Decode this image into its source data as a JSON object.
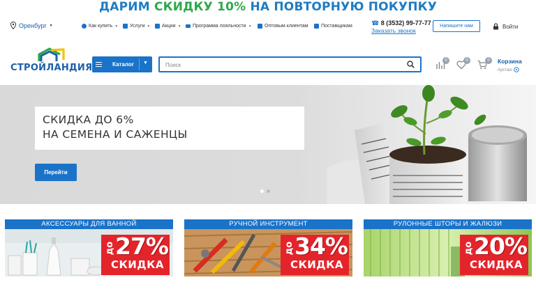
{
  "promo": {
    "part1": "ДАРИМ ",
    "part2": "СКИДКУ 10%",
    "part3": " НА ПОВТОРНУЮ ПОКУПКУ"
  },
  "header": {
    "city": "Оренбург",
    "nav": [
      {
        "label": "Как купить",
        "caret": true
      },
      {
        "label": "Услуги",
        "caret": true
      },
      {
        "label": "Акции",
        "caret": true
      },
      {
        "label": "Программа лояльности",
        "caret": true
      },
      {
        "label": "Оптовым клиентам",
        "caret": false
      },
      {
        "label": "Поставщикам",
        "caret": false
      }
    ],
    "phone": "8 (3532) 99-77-77",
    "callback": "Заказать звонок",
    "write_button": "Напишите нам",
    "login": "Войти"
  },
  "logo": {
    "text": "СТРОЙЛАНДИЯ"
  },
  "catalog": {
    "label": "Каталог"
  },
  "search": {
    "placeholder": "Поиск"
  },
  "counters": {
    "compare": "0",
    "favorites": "0",
    "cart": "0"
  },
  "cart": {
    "title": "Корзина",
    "status": "пустая"
  },
  "hero": {
    "line1": "СКИДКА ДО 6%",
    "line2": "НА СЕМЕНА И САЖЕНЦЫ",
    "button": "Перейти"
  },
  "categories": [
    {
      "title": "АКСЕССУАРЫ ДЛЯ ВАННОЙ",
      "prefix": "до",
      "percent": "27%",
      "word": "СКИДКА"
    },
    {
      "title": "РУЧНОЙ ИНСТРУМЕНТ",
      "prefix": "до",
      "percent": "34%",
      "word": "СКИДКА"
    },
    {
      "title": "РУЛОННЫЕ ШТОРЫ И ЖАЛЮЗИ",
      "prefix": "до",
      "percent": "20%",
      "word": "СКИДКА"
    }
  ],
  "colors": {
    "brand_blue": "#1a73c9",
    "promo_green": "#2ea84a",
    "sale_red": "#e4242b"
  }
}
